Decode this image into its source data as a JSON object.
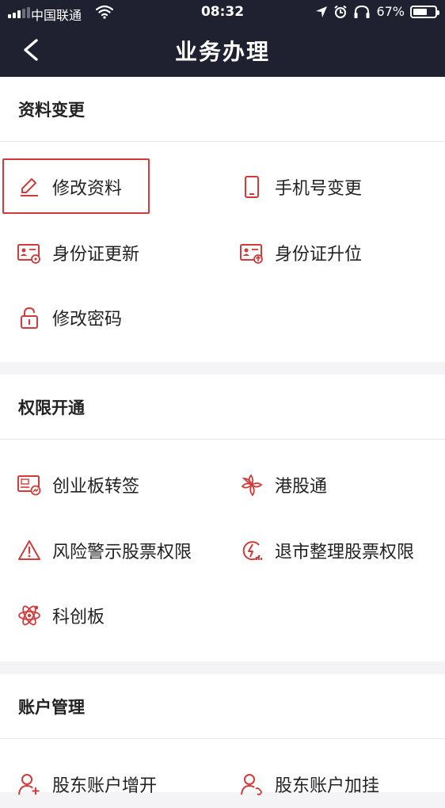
{
  "status": {
    "carrier": "中国联通",
    "time": "08:32",
    "battery_text": "67%",
    "battery_level": 0.67
  },
  "nav": {
    "back_icon": "chevron-left-icon",
    "title": "业务办理"
  },
  "colors": {
    "header_bg": "#1f2131",
    "icon_red": "#d23b3b",
    "highlight": "#cf3b3b"
  },
  "sections": [
    {
      "title": "资料变更",
      "items": [
        {
          "label": "修改资料",
          "icon": "edit-pencil-icon"
        },
        {
          "label": "手机号变更",
          "icon": "mobile-phone-icon"
        },
        {
          "label": "身份证更新",
          "icon": "id-card-update-icon"
        },
        {
          "label": "身份证升位",
          "icon": "id-card-upgrade-icon"
        },
        {
          "label": "修改密码",
          "icon": "lock-icon"
        }
      ]
    },
    {
      "title": "权限开通",
      "items": [
        {
          "label": "创业板转签",
          "icon": "chinext-card-icon"
        },
        {
          "label": "港股通",
          "icon": "bauhinia-flower-icon"
        },
        {
          "label": "风险警示股票权限",
          "icon": "warning-triangle-icon"
        },
        {
          "label": "退市整理股票权限",
          "icon": "delisting-bolt-icon"
        },
        {
          "label": "科创板",
          "icon": "atom-icon"
        }
      ]
    },
    {
      "title": "账户管理",
      "items": [
        {
          "label": "股东账户增开",
          "icon": "user-add-icon"
        },
        {
          "label": "股东账户加挂",
          "icon": "user-link-icon"
        }
      ]
    }
  ]
}
